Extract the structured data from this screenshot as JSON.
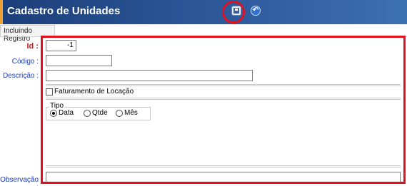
{
  "window": {
    "title": "Cadastro de Unidades"
  },
  "toolbar": {
    "save_icon": "save-icon",
    "undo_icon": "undo-icon",
    "undo_glyph": "↶"
  },
  "tabs": [
    {
      "label": "Incluindo Registro"
    }
  ],
  "form": {
    "id": {
      "label": "Id :",
      "value": "-1"
    },
    "codigo": {
      "label": "Código :",
      "value": ""
    },
    "descricao": {
      "label": "Descrição :",
      "value": ""
    },
    "faturamento": {
      "label": "Faturamento de Locação",
      "checked": false
    },
    "tipo": {
      "title": "Tipo",
      "options": [
        "Data",
        "Qtde",
        "Mês"
      ],
      "selected": "Data"
    },
    "observacao": {
      "label": "Observação :",
      "value": ""
    }
  },
  "colors": {
    "highlight": "#e01020",
    "label_blue": "#1a3cbf",
    "label_red": "#e0101a",
    "titlebar": "#2a5596"
  }
}
